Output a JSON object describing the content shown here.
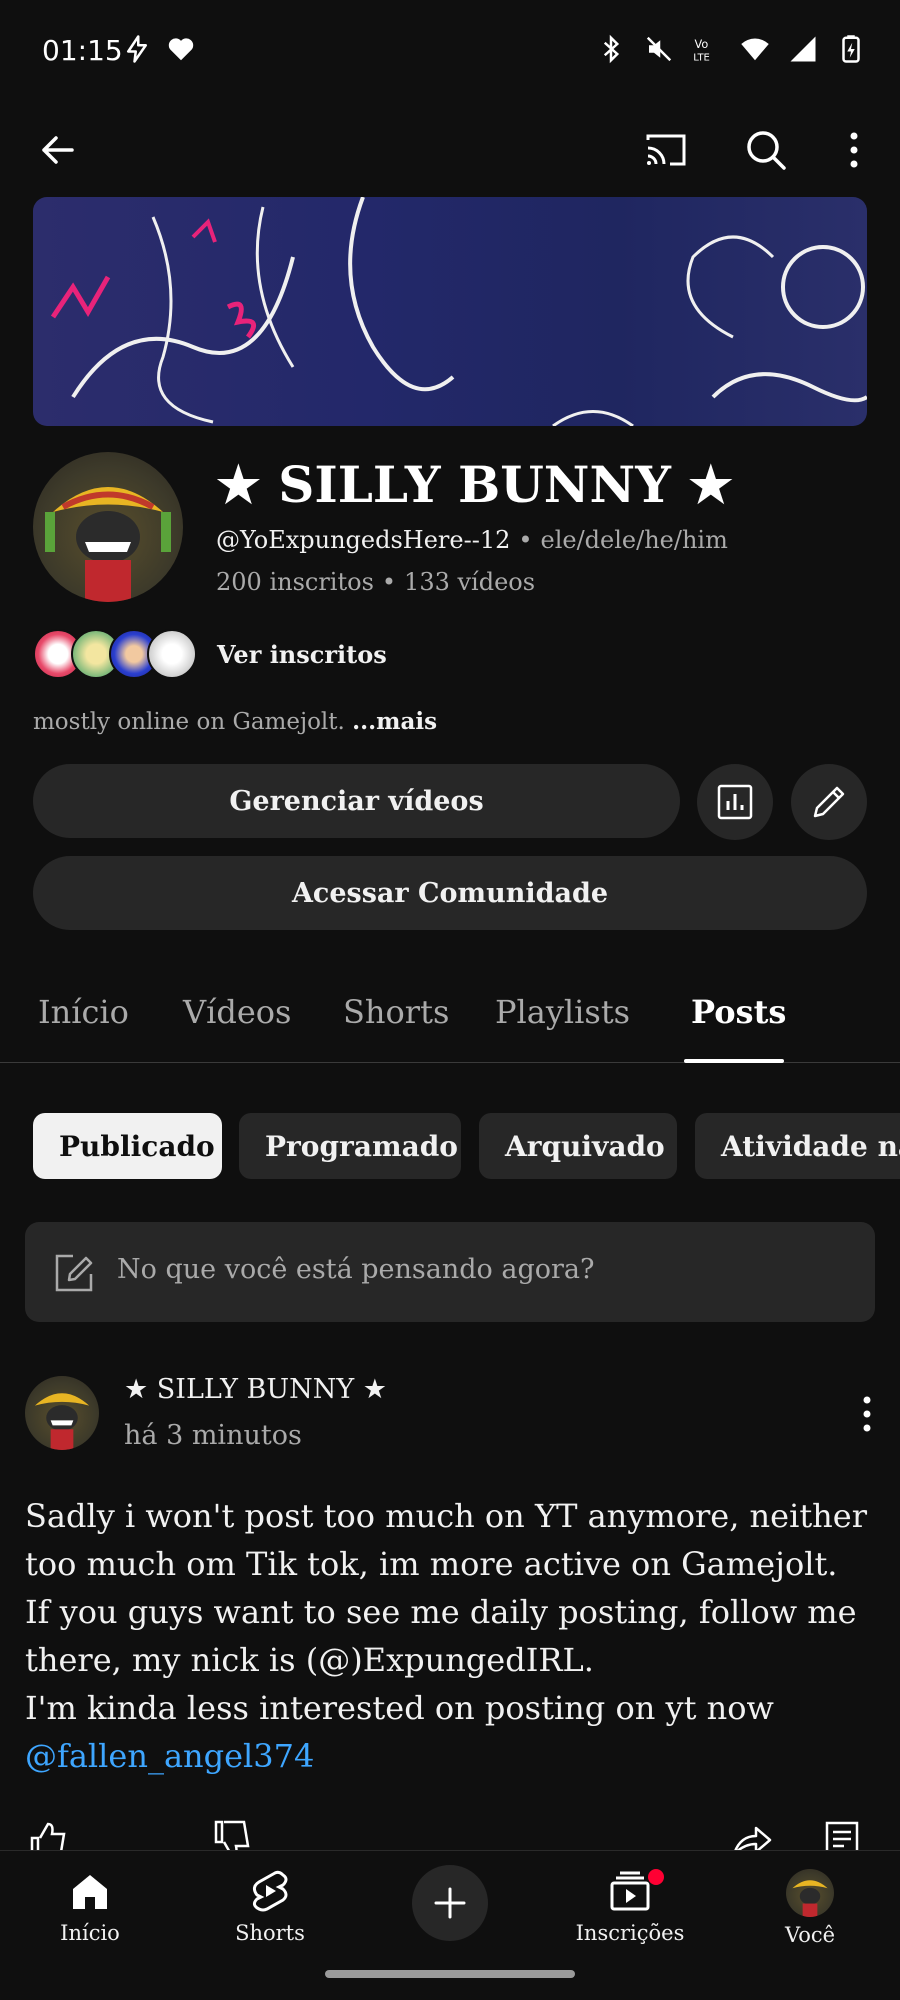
{
  "status_bar": {
    "time": "01:15"
  },
  "top_bar": {},
  "channel": {
    "title": "★ SILLY BUNNY ★",
    "handle": "@YoExpungedsHere--12",
    "pronouns": "ele/dele/he/him",
    "subscribers": "200 inscritos",
    "videos": "133 vídeos",
    "see_subscribers": "Ver inscritos",
    "description": "mostly online on Gamejolt.",
    "description_more": "...mais"
  },
  "buttons": {
    "manage_videos": "Gerenciar vídeos",
    "community": "Acessar Comunidade"
  },
  "tabs": [
    "Início",
    "Vídeos",
    "Shorts",
    "Playlists",
    "Posts"
  ],
  "active_tab": "Posts",
  "chips": [
    "Publicado",
    "Programado",
    "Arquivado",
    "Atividade nas"
  ],
  "composer": {
    "placeholder": "No que você está pensando agora?"
  },
  "post": {
    "author": "★ SILLY BUNNY ★",
    "time": "há 3 minutos",
    "lines": [
      "Sadly i won't post too much on YT anymore, neither",
      "too much om Tik tok, im more active on Gamejolt.",
      "If you guys want to see me daily posting, follow me",
      "there, my nick is (@)ExpungedIRL.",
      "I'm kinda less interested on posting on yt now"
    ],
    "mention": "@fallen_angel374"
  },
  "bottom_nav": {
    "home": "Início",
    "shorts": "Shorts",
    "subscriptions": "Inscrições",
    "you": "Você"
  },
  "colors": {
    "background": "#0f0f0f",
    "surface": "#272727",
    "link": "#3ea6ff",
    "badge": "#ff0033"
  }
}
